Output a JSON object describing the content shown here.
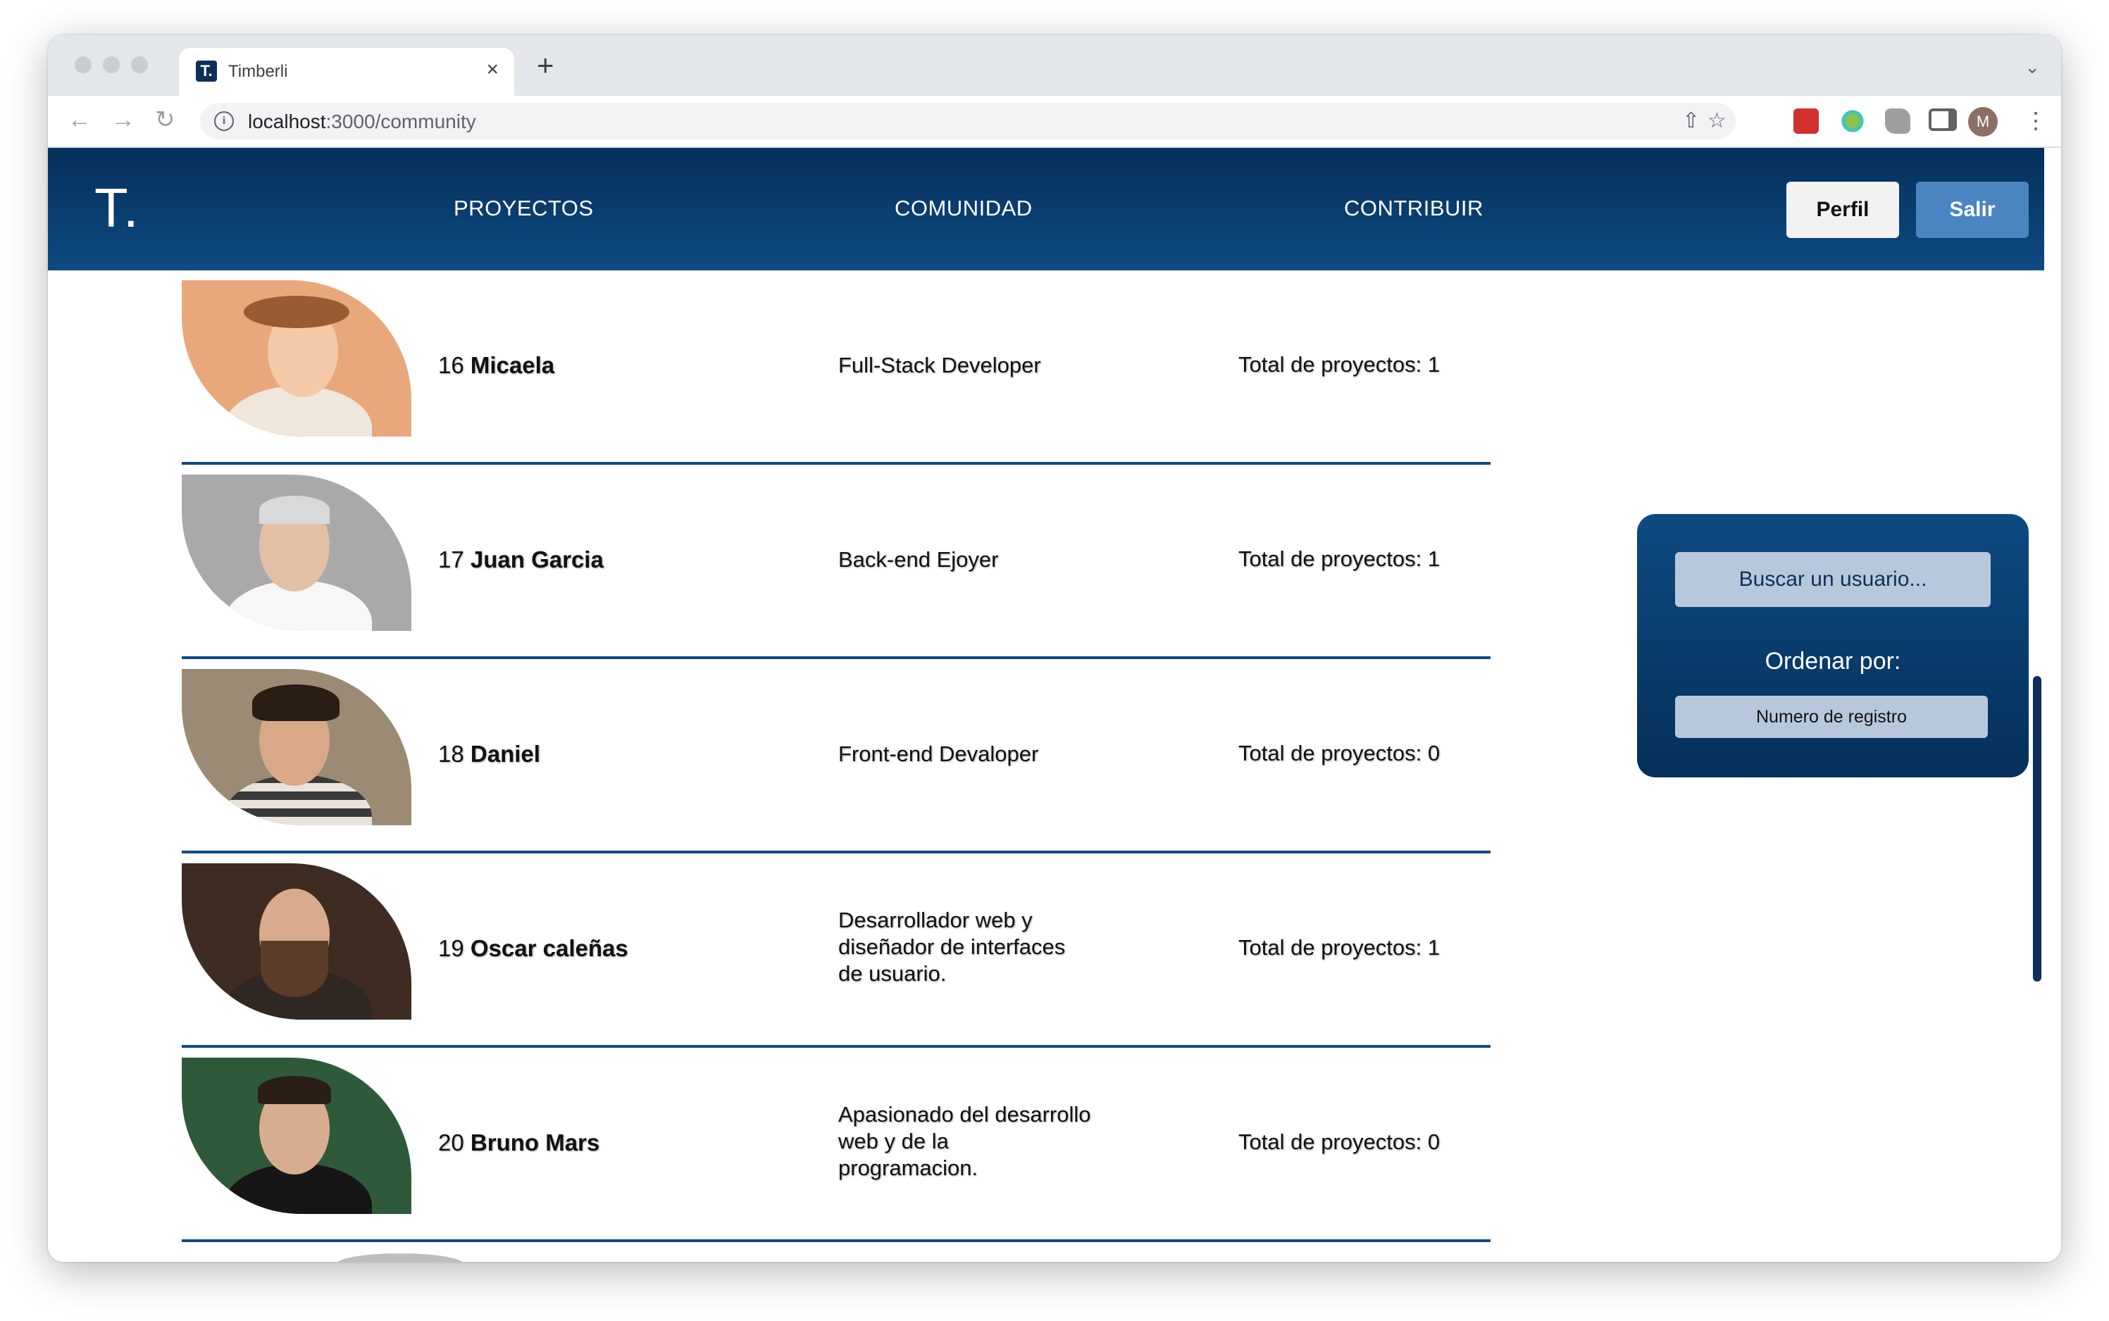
{
  "browser": {
    "tab_title": "Timberli",
    "favicon_letter": "T.",
    "close_glyph": "×",
    "newtab_glyph": "+",
    "url_host": "localhost",
    "url_path": ":3000/community"
  },
  "navbar": {
    "logo": "T.",
    "links": [
      "PROYECTOS",
      "COMUNIDAD",
      "CONTRIBUIR"
    ],
    "profile_label": "Perfil",
    "logout_label": "Salir"
  },
  "users": [
    {
      "num": "16",
      "name": "Micaela",
      "role": "Full-Stack Developer",
      "total": "Total de proyectos: 1"
    },
    {
      "num": "17",
      "name": "Juan Garcia",
      "role": "Back-end Ejoyer",
      "total": "Total de proyectos: 1"
    },
    {
      "num": "18",
      "name": "Daniel",
      "role": "Front-end Devaloper",
      "total": "Total de proyectos: 0"
    },
    {
      "num": "19",
      "name": "Oscar caleñas",
      "role": "Desarrollador web y diseñador de interfaces de usuario.",
      "total": "Total de proyectos: 1"
    },
    {
      "num": "20",
      "name": "Bruno Mars",
      "role": "Apasionado del desarrollo web y de la programacion.",
      "total": "Total de proyectos: 0"
    }
  ],
  "sidebar": {
    "search_placeholder": "Buscar un usuario...",
    "order_label": "Ordenar por:",
    "order_value": "Numero de registro"
  },
  "colors": {
    "navbar": "#0d4a82",
    "accent_button": "#4a84c1"
  }
}
